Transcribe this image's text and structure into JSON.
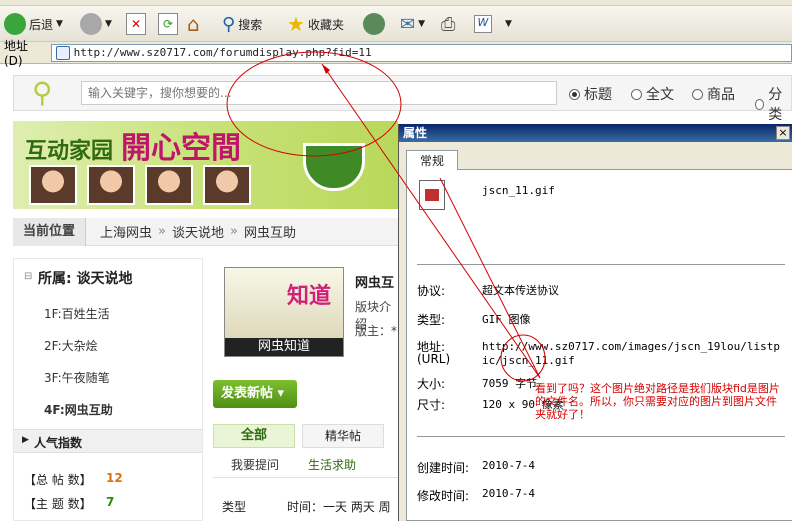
{
  "toolbar": {
    "back": "后退",
    "search": "搜索",
    "favorites": "收藏夹"
  },
  "address": {
    "label": "地址(D)",
    "url": "http://www.sz0717.com/forumdisplay.php?fid=11"
  },
  "search": {
    "placeholder": "输入关键字，搜你想要的...",
    "options": [
      "标题",
      "全文",
      "商品",
      "分类"
    ]
  },
  "banner": {
    "title_a": "互动家园",
    "title_b": "開心空間"
  },
  "breadcrumb": {
    "current": "当前位置",
    "items": [
      "上海网虫",
      "谈天说地",
      "网虫互助"
    ],
    "sep": "»"
  },
  "sidebar": {
    "heading": "所属: 谈天说地",
    "items": [
      "1F:百姓生活",
      "2F:大杂烩",
      "3F:午夜随笔",
      "4F:网虫互助"
    ],
    "popular": "人气指数",
    "stats": [
      {
        "label": "【总 帖 数】",
        "value": "12"
      },
      {
        "label": "【主 题 数】",
        "value": "7"
      }
    ]
  },
  "forum": {
    "logo_text": "知道",
    "logo_caption": "网虫知道",
    "name": "网虫互",
    "intro": "版块介绍",
    "mod": "版主：*",
    "post_button": "发表新帖",
    "tabs": [
      "全部",
      "精华帖"
    ],
    "subtabs": [
      "我要提问",
      "生活求助"
    ],
    "type_label": "类型",
    "time_label": "时间：一天 两天 周"
  },
  "dialog": {
    "title": "属性",
    "close": "×",
    "tab": "常规",
    "filename": "jscn_11.gif",
    "rows": [
      {
        "label": "协议:",
        "value": "超文本传送协议"
      },
      {
        "label": "类型:",
        "value": "GIF 图像"
      },
      {
        "label": "地址:",
        "sub": "(URL)",
        "value": "http://www.sz0717.com/images/jscn_19lou/listpic/jscn_11.gif"
      },
      {
        "label": "大小:",
        "value": "7059 字节"
      },
      {
        "label": "尺寸:",
        "value": "120  x  90 像素"
      },
      {
        "label": "创建时间:",
        "value": "2010-7-4"
      },
      {
        "label": "修改时间:",
        "value": "2010-7-4"
      }
    ],
    "note": "看到了吗？这个图片绝对路径是我们版块fid是图片的文件名。所以，你只需要对应的图片到图片文件夹就好了！"
  },
  "colors": {
    "annotation": "#d40000",
    "title_bar": "#0a246a",
    "post_button": "#5a9a1a"
  }
}
